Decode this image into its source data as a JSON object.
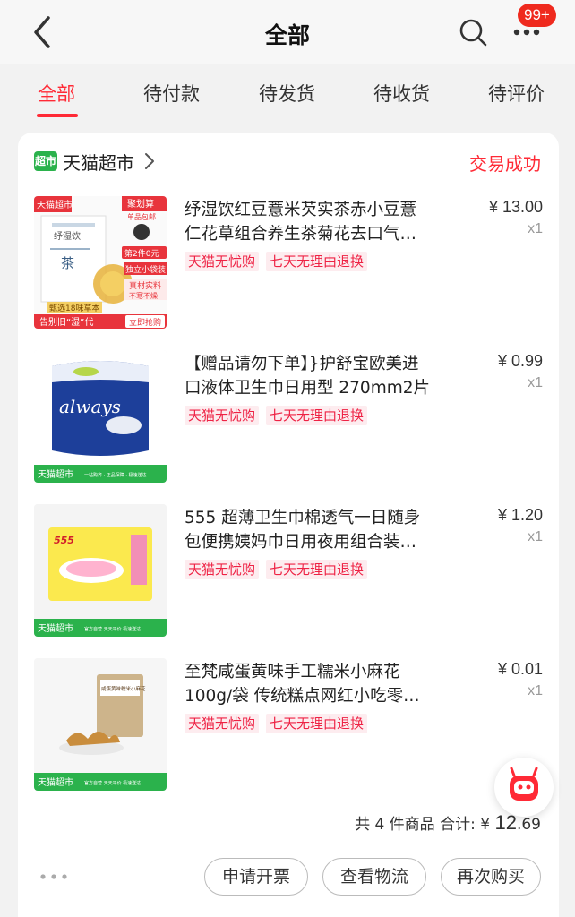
{
  "header": {
    "title": "全部",
    "badge": "99+",
    "back_icon": "chevron-left-icon",
    "search_icon": "search-icon",
    "more_icon": "more-dots-icon"
  },
  "tabs": [
    {
      "label": "全部",
      "active": true
    },
    {
      "label": "待付款",
      "active": false
    },
    {
      "label": "待发货",
      "active": false
    },
    {
      "label": "待收货",
      "active": false
    },
    {
      "label": "待评价",
      "active": false
    }
  ],
  "order": {
    "shop_logo": "超市",
    "shop_name": "天猫超市",
    "status": "交易成功",
    "items": [
      {
        "name_line1": "纾湿饮红豆薏米芡实茶赤小豆薏",
        "name_line2": "仁花草组合养生茶菊花去口气…",
        "price": "¥ 13.00",
        "qty": "x1",
        "tags": [
          "天猫无忧购",
          "七天无理由退换"
        ],
        "image_text": {
          "corner": "天猫超市",
          "brand": "纾湿饮",
          "tea": "茶",
          "promo_top": "聚划算",
          "promo_free": "单品包邮",
          "promo_second": "第2件0元",
          "feature1": "独立小袋装",
          "feature2": "真材实料",
          "feature3": "不寒不燥",
          "herbs": "甄选18味草本",
          "slogan": "告别旧“湿”代",
          "buy": "立即抢购"
        }
      },
      {
        "name_line1": "【赠品请勿下单】}护舒宝欧美进",
        "name_line2": "口液体卫生巾日用型 270mm2片",
        "price": "¥ 0.99",
        "qty": "x1",
        "tags": [
          "天猫无忧购",
          "七天无理由退换"
        ],
        "image_text": {
          "brand": "always",
          "bottom": "天猫超市",
          "bottom_sub": "一站购齐 · 正品保障 · 极速送达"
        }
      },
      {
        "name_line1": "555 超薄卫生巾棉透气一日随身",
        "name_line2": "包便携姨妈巾日用夜用组合装…",
        "price": "¥ 1.20",
        "qty": "x1",
        "tags": [
          "天猫无忧购",
          "七天无理由退换"
        ],
        "image_text": {
          "brand": "555",
          "bottom": "天猫超市",
          "bottom_sub": "官方自营  天天平价  极速送达"
        }
      },
      {
        "name_line1": "至梵咸蛋黄味手工糯米小麻花",
        "name_line2": "100g/袋 传统糕点网红小吃零…",
        "price": "¥ 0.01",
        "qty": "x1",
        "tags": [
          "天猫无忧购",
          "七天无理由退换"
        ],
        "image_text": {
          "bag": "咸蛋黄味糯米小麻花",
          "bottom": "天猫超市",
          "bottom_sub": "官方自营  天天平价  极速送达"
        }
      }
    ],
    "summary_prefix": "共 4 件商品  合计:",
    "summary_currency": "¥",
    "summary_total": "12",
    "summary_decimal": ".69",
    "buttons": [
      "申请开票",
      "查看物流",
      "再次购买"
    ],
    "more_icon": "more-horizontal-icon"
  },
  "colors": {
    "accent": "#ff2a36",
    "tmall_green": "#2bb24c",
    "tag_bg": "#fdecef"
  }
}
